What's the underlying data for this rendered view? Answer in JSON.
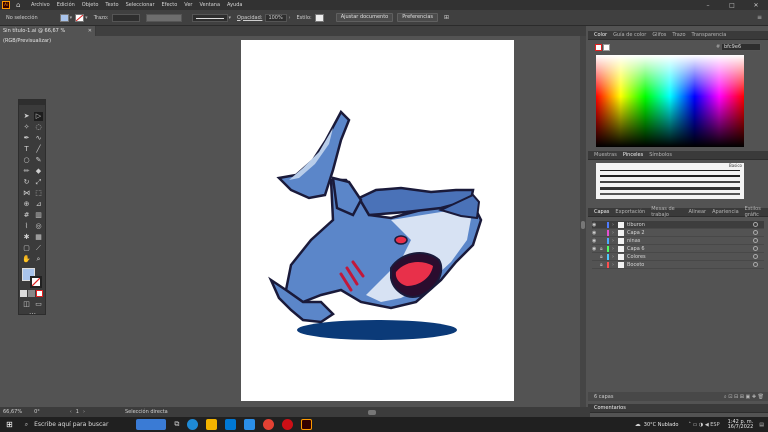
{
  "app": {
    "logo_text": "Ai"
  },
  "menu": {
    "items": [
      "Archivo",
      "Edición",
      "Objeto",
      "Texto",
      "Seleccionar",
      "Efecto",
      "Ver",
      "Ventana",
      "Ayuda"
    ]
  },
  "control_bar": {
    "selection_label": "No selección",
    "stroke_label": "Trazo:",
    "opacity_label": "Opacidad:",
    "opacity_value": "100%",
    "style_label": "Estilo:",
    "adjust_button": "Ajustar documento",
    "prefs_button": "Preferencias"
  },
  "document": {
    "tab_title": "Sin título-1.ai @ 66,67 % (RGB/Previsualizar)"
  },
  "panels": {
    "color_tabs": [
      "Color",
      "Guía de color",
      "Glifos",
      "Trazo",
      "Transparencia"
    ],
    "hex_value": "bfc9e6",
    "brush_tabs": [
      "Muestras",
      "Pinceles",
      "Símbolos"
    ],
    "brush_label": "Basico",
    "layer_tabs": [
      "Capas",
      "Exportación",
      "Mesas de trabajo",
      "Alinear",
      "Apariencia",
      "Estilos gráfic"
    ],
    "layers": [
      {
        "name": "tiburon",
        "color": "#4f7cff"
      },
      {
        "name": "Capa 2",
        "color": "#e64fd1"
      },
      {
        "name": "ninas",
        "color": "#4fa8ff"
      },
      {
        "name": "Capa 6",
        "color": "#4fff63"
      },
      {
        "name": "Colores",
        "color": "#4fc8ff"
      },
      {
        "name": "Boceto",
        "color": "#ff4f4f"
      }
    ],
    "layers_count": "6 capas",
    "comments_tab": "Comentarios"
  },
  "status": {
    "zoom": "66,67%",
    "rotation": "0°",
    "page": "1",
    "tool": "Selección directa"
  },
  "taskbar": {
    "search_placeholder": "Escribe aquí para buscar",
    "weather": "30°C  Nublado",
    "time": "1:42 p. m.",
    "date": "16/7/2022"
  }
}
